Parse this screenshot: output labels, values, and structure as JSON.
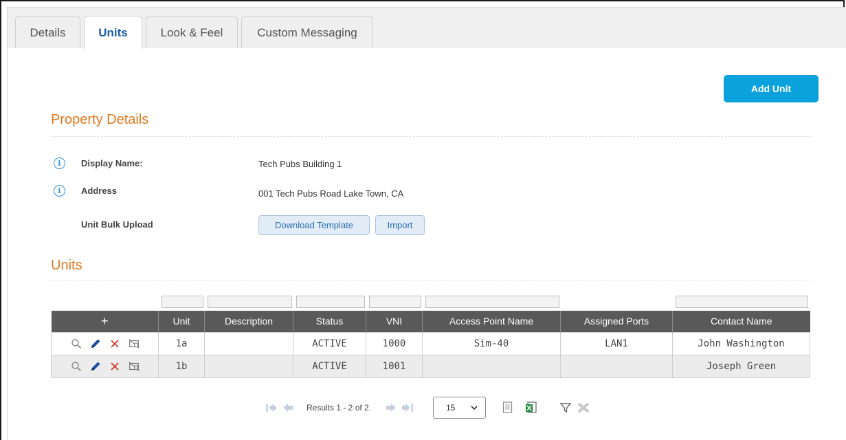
{
  "tabs": [
    {
      "label": "Details",
      "active": false
    },
    {
      "label": "Units",
      "active": true
    },
    {
      "label": "Look & Feel",
      "active": false
    },
    {
      "label": "Custom Messaging",
      "active": false
    }
  ],
  "add_unit_label": "Add Unit",
  "property_details": {
    "title": "Property Details",
    "display_name_label": "Display Name:",
    "display_name_value": "Tech Pubs Building 1",
    "address_label": "Address",
    "address_value": "001 Tech Pubs Road Lake Town, CA",
    "bulk_upload_label": "Unit Bulk Upload",
    "download_template_label": "Download Template",
    "import_label": "Import"
  },
  "units": {
    "title": "Units",
    "columns": [
      "+",
      "Unit",
      "Description",
      "Status",
      "VNI",
      "Access Point Name",
      "Assigned Ports",
      "Contact Name"
    ],
    "rows": [
      {
        "unit": "1a",
        "description": "",
        "status": "ACTIVE",
        "vni": "1000",
        "ap_name": "Sim-40",
        "ports": "LAN1",
        "contact": "John Washington"
      },
      {
        "unit": "1b",
        "description": "",
        "status": "ACTIVE",
        "vni": "1001",
        "ap_name": "",
        "ports": "",
        "contact": "Joseph Green"
      }
    ]
  },
  "pager": {
    "results_text": "Results 1 - 2 of 2.",
    "page_size": "15"
  },
  "colors": {
    "accent_orange": "#e07a1f",
    "primary_blue": "#0aa1dd",
    "header_gray": "#595959"
  }
}
